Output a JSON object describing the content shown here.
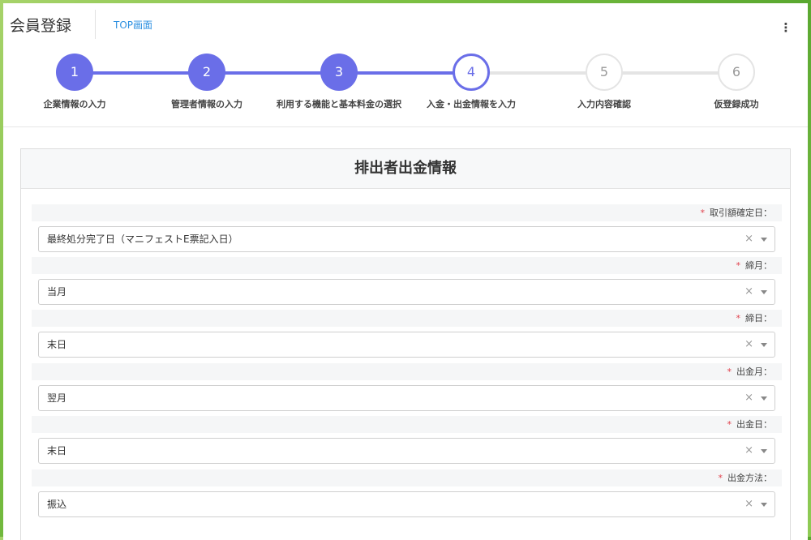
{
  "header": {
    "title": "会員登録",
    "top_link": "TOP画面",
    "menu_icon": "⋮"
  },
  "stepper": {
    "current_step": 4,
    "accent_color": "#6a6ee8",
    "steps": [
      {
        "number": "1",
        "label": "企業情報の入力",
        "state": "done"
      },
      {
        "number": "2",
        "label": "管理者情報の入力",
        "state": "done"
      },
      {
        "number": "3",
        "label": "利用する機能と基本料金の選択",
        "state": "done"
      },
      {
        "number": "4",
        "label": "入金・出金情報を入力",
        "state": "active"
      },
      {
        "number": "5",
        "label": "入力内容確認",
        "state": "todo"
      },
      {
        "number": "6",
        "label": "仮登録成功",
        "state": "todo"
      }
    ]
  },
  "form": {
    "title": "排出者出金情報",
    "required_mark": "*",
    "fields": [
      {
        "label": "取引額確定日：",
        "value": "最終処分完了日（マニフェストE票記入日）"
      },
      {
        "label": "締月：",
        "value": "当月"
      },
      {
        "label": "締日：",
        "value": "末日"
      },
      {
        "label": "出金月：",
        "value": "翌月"
      },
      {
        "label": "出金日：",
        "value": "末日"
      },
      {
        "label": "出金方法：",
        "value": "振込"
      }
    ],
    "clear_icon": "×"
  }
}
